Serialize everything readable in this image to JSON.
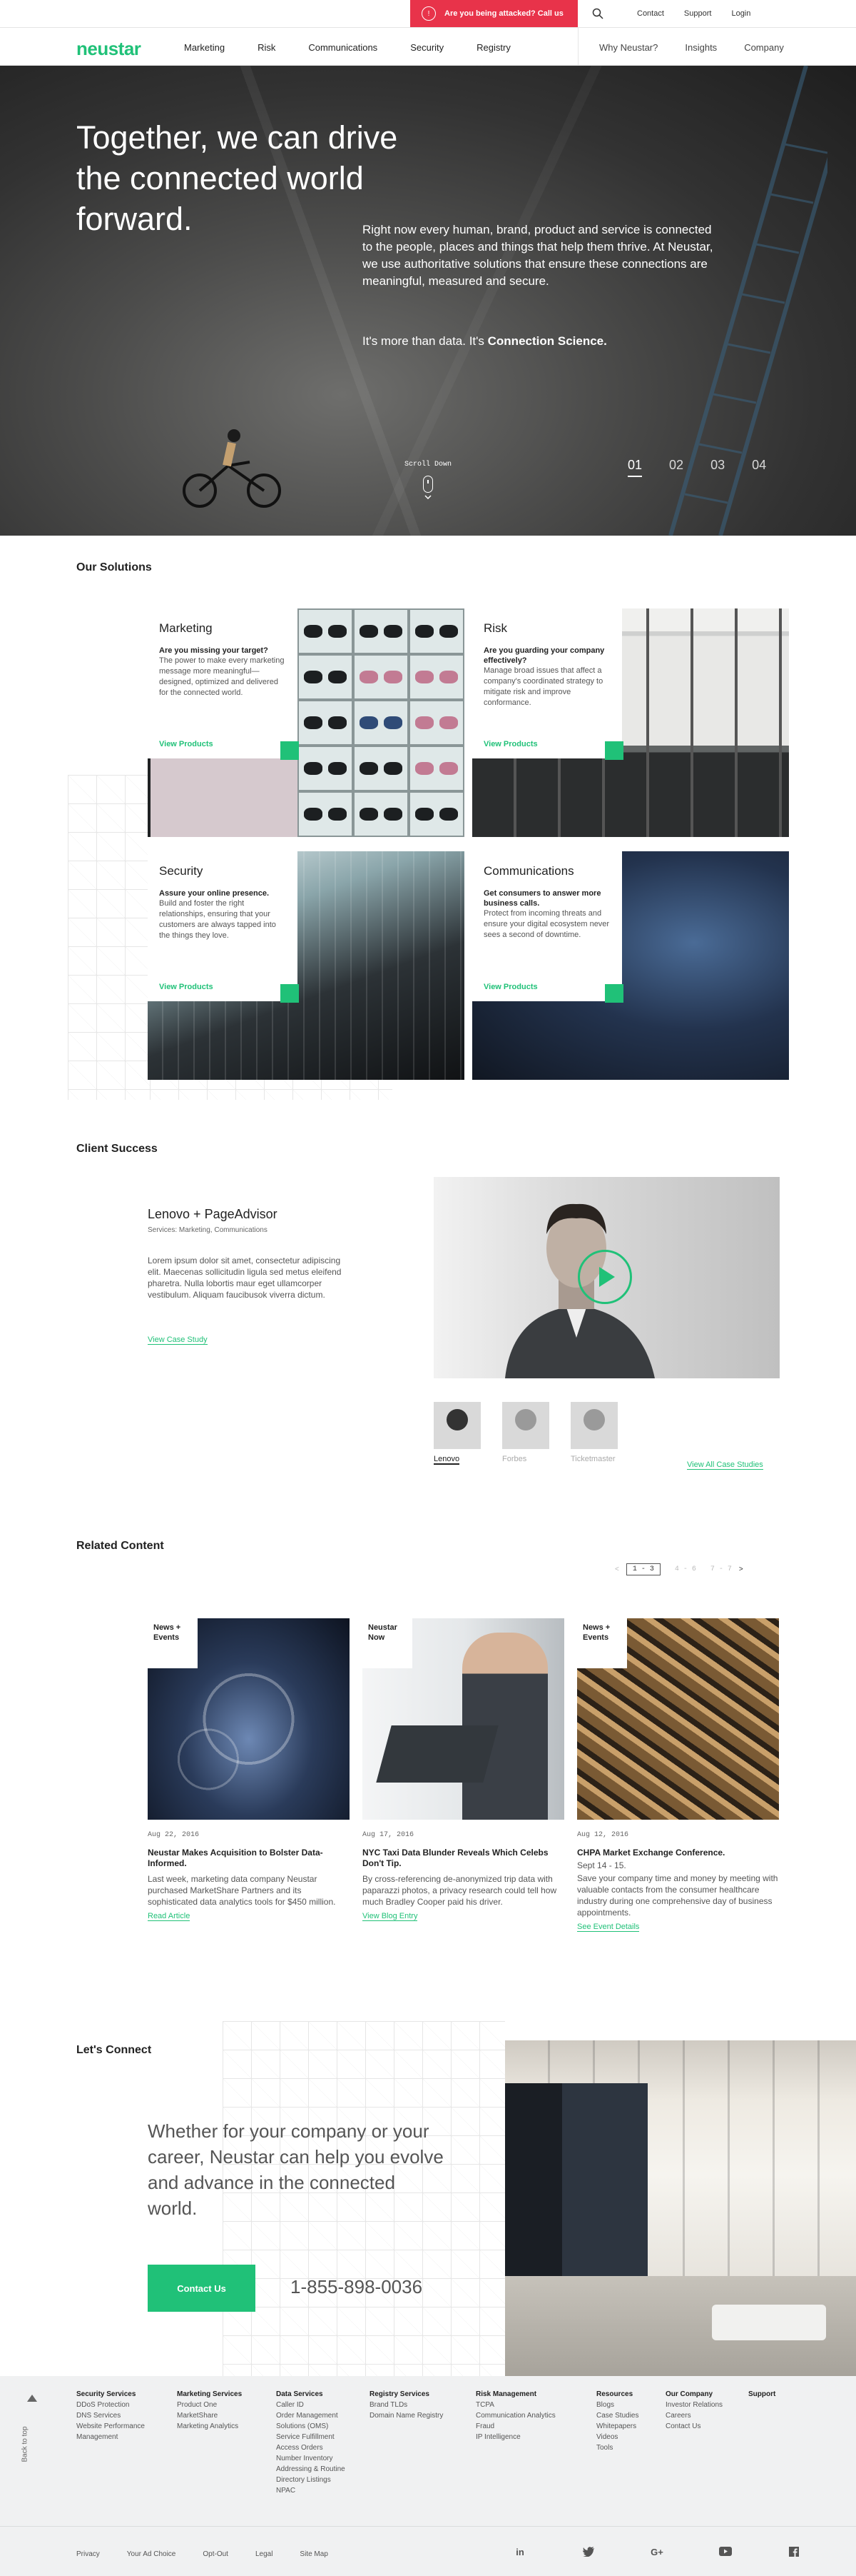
{
  "utility": {
    "alert_text": "Are you being attacked? Call us",
    "links": [
      "Contact",
      "Support",
      "Login"
    ]
  },
  "nav": {
    "logo": "neustar",
    "primary": [
      "Marketing",
      "Risk",
      "Communications",
      "Security",
      "Registry"
    ],
    "secondary": [
      "Why Neustar?",
      "Insights",
      "Company"
    ]
  },
  "hero": {
    "headline": "Together, we can drive the connected world forward.",
    "lede": "Right now every human, brand, product and service is connected to the people, places and things that help them thrive. At Neustar, we use authoritative solutions that ensure these connections are meaningful, measured and secure.",
    "tag_prefix": "It's more than data. It's",
    "tag_strong": "Connection Science.",
    "scroll_label": "Scroll Down",
    "slides": [
      "01",
      "02",
      "03",
      "04"
    ],
    "active_slide": "01"
  },
  "solutions": {
    "heading": "Our Solutions",
    "cards": [
      {
        "title": "Marketing",
        "question": "Are you missing your target?",
        "desc": "The power to make every marketing message more meaningful—designed, optimized and delivered for the connected world.",
        "link": "View Products"
      },
      {
        "title": "Risk",
        "question": "Are you guarding your company effectively?",
        "desc": "Manage broad issues that affect a company's coordinated strategy to mitigate risk and improve conformance.",
        "link": "View Products"
      },
      {
        "title": "Security",
        "question": "Assure your online presence.",
        "desc": "Build and foster the right relationships, ensuring that your customers are always tapped into the things they love.",
        "link": "View Products"
      },
      {
        "title": "Communications",
        "question": "Get consumers to answer more business calls.",
        "desc": "Protect from incoming threats and ensure your digital ecosystem never sees a second of downtime.",
        "link": "View Products"
      }
    ]
  },
  "client_success": {
    "heading": "Client Success",
    "title": "Lenovo + PageAdvisor",
    "services": "Services: Marketing, Communications",
    "body": "Lorem ipsum dolor sit amet, consectetur adipiscing elit. Maecenas sollicitudin ligula sed metus eleifend pharetra. Nulla lobortis maur eget ullamcorper vestibulum. Aliquam faucibusok viverra dictum.",
    "link": "View Case Study",
    "clients": [
      "Lenovo",
      "Forbes",
      "Ticketmaster"
    ],
    "all_link": "View All Case Studies"
  },
  "related": {
    "heading": "Related Content",
    "pager": {
      "prev": "<",
      "current": "1 - 3",
      "p2": "4 - 6",
      "p3": "7 - 7",
      "next": ">"
    },
    "items": [
      {
        "label": "News + Events",
        "date": "Aug 22, 2016",
        "title": "Neustar Makes Acquisition to Bolster Data-Informed.",
        "desc": "Last week, marketing data company Neustar purchased MarketShare Partners and its sophisticated data analytics tools for $450 million.",
        "link": "Read Article"
      },
      {
        "label": "Neustar Now",
        "date": "Aug 17, 2016",
        "title": "NYC Taxi Data Blunder Reveals Which Celebs Don't Tip.",
        "desc": "By cross-referencing de-anonymized trip data with paparazzi photos, a privacy research could tell how much Bradley Cooper paid his driver.",
        "link": "View Blog Entry"
      },
      {
        "label": "News + Events",
        "date": "Aug 12, 2016",
        "title": "CHPA Market Exchange Conference.",
        "subtitle": "Sept 14 - 15.",
        "desc": "Save your company time and money by meeting with valuable contacts from the consumer healthcare industry during one comprehensive day of business appointments.",
        "link": "See Event Details"
      }
    ]
  },
  "connect": {
    "heading": "Let's Connect",
    "text": "Whether for your company or your career, Neustar can help you evolve and advance in the connected world.",
    "button": "Contact Us",
    "phone": "1-855-898-0036"
  },
  "footer": {
    "back_to_top": "Back to top",
    "columns": [
      {
        "head": "Security Services",
        "items": [
          "DDoS Protection",
          "DNS Services",
          "Website Performance Management"
        ]
      },
      {
        "head": "Marketing Services",
        "items": [
          "Product One",
          "MarketShare",
          "Marketing Analytics"
        ]
      },
      {
        "head": "Data Services",
        "items": [
          "Caller ID",
          "Order Management Solutions (OMS)",
          "Service Fulfillment",
          "Access Orders",
          "Number Inventory",
          "Addressing & Routine",
          "Directory Listings",
          "NPAC"
        ]
      },
      {
        "head": "Registry Services",
        "items": [
          "Brand TLDs",
          "Domain Name Registry"
        ]
      },
      {
        "head": "Risk Management",
        "items": [
          "TCPA",
          "Communication Analytics",
          "Fraud",
          "IP Intelligence"
        ]
      },
      {
        "head": "Resources",
        "items": [
          "Blogs",
          "Case Studies",
          "Whitepapers",
          "Videos",
          "Tools"
        ]
      },
      {
        "head": "Our Company",
        "items": [
          "Investor Relations",
          "Careers",
          "Contact Us"
        ]
      },
      {
        "head": "Support",
        "items": []
      }
    ],
    "legal": [
      "Privacy",
      "Your Ad Choice",
      "Opt-Out",
      "Legal",
      "Site Map"
    ],
    "social_icons": [
      "linkedin-icon",
      "twitter-icon",
      "googleplus-icon",
      "youtube-icon",
      "facebook-icon"
    ]
  },
  "colors": {
    "accent": "#20c178",
    "alert": "#e8334a"
  }
}
